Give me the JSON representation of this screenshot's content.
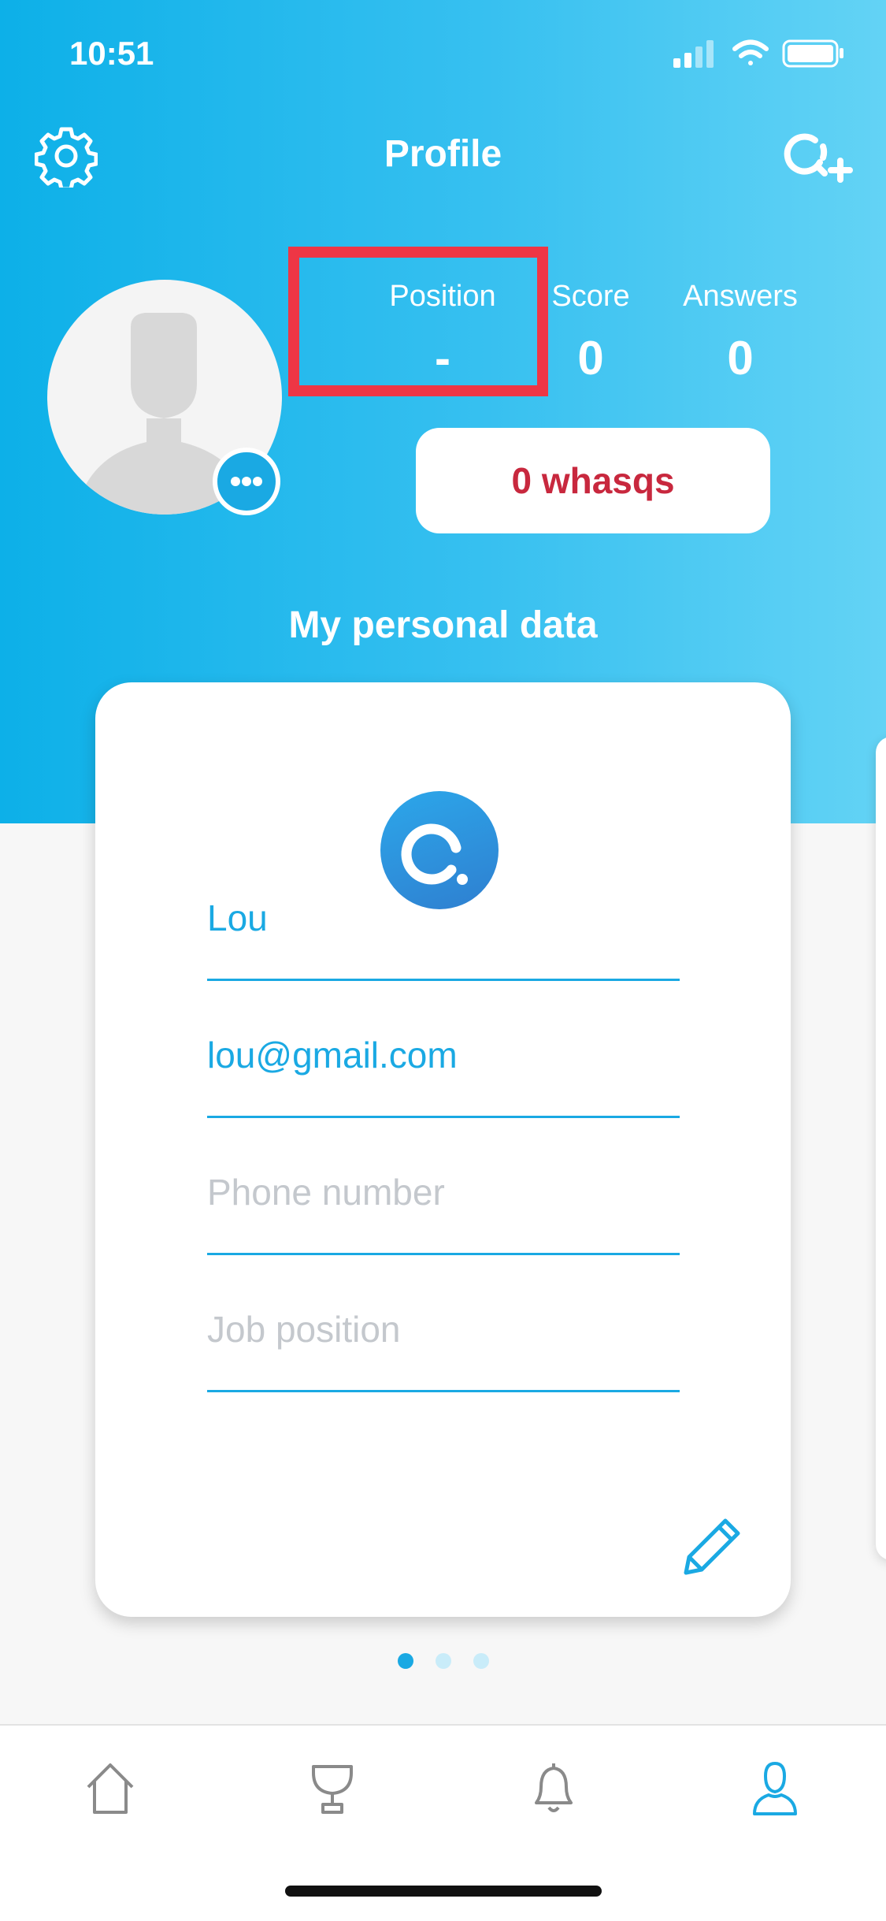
{
  "status_bar": {
    "time": "10:51"
  },
  "header": {
    "title": "Profile",
    "settings_icon": "gear-icon",
    "add_icon": "add-question-icon"
  },
  "stats": [
    {
      "label": "Position",
      "value": "-"
    },
    {
      "label": "Score",
      "value": "0"
    },
    {
      "label": "Answers",
      "value": "0"
    }
  ],
  "whasqs_button": {
    "label": "0 whasqs"
  },
  "section": {
    "title": "My personal data"
  },
  "card": {
    "fields": [
      {
        "value": "Lou",
        "placeholder": ""
      },
      {
        "value": "lou@gmail.com",
        "placeholder": ""
      },
      {
        "value": "",
        "placeholder": "Phone number"
      },
      {
        "value": "",
        "placeholder": "Job position"
      }
    ]
  },
  "pager": {
    "pages": 3,
    "active": 1
  },
  "tabs": [
    {
      "icon": "home-icon",
      "active": false
    },
    {
      "icon": "trophy-icon",
      "active": false
    },
    {
      "icon": "bell-icon",
      "active": false
    },
    {
      "icon": "user-icon",
      "active": true
    }
  ],
  "colors": {
    "accent": "#1aa9e3",
    "whasqs_text": "#c8283e",
    "highlight": "#ee3645"
  }
}
